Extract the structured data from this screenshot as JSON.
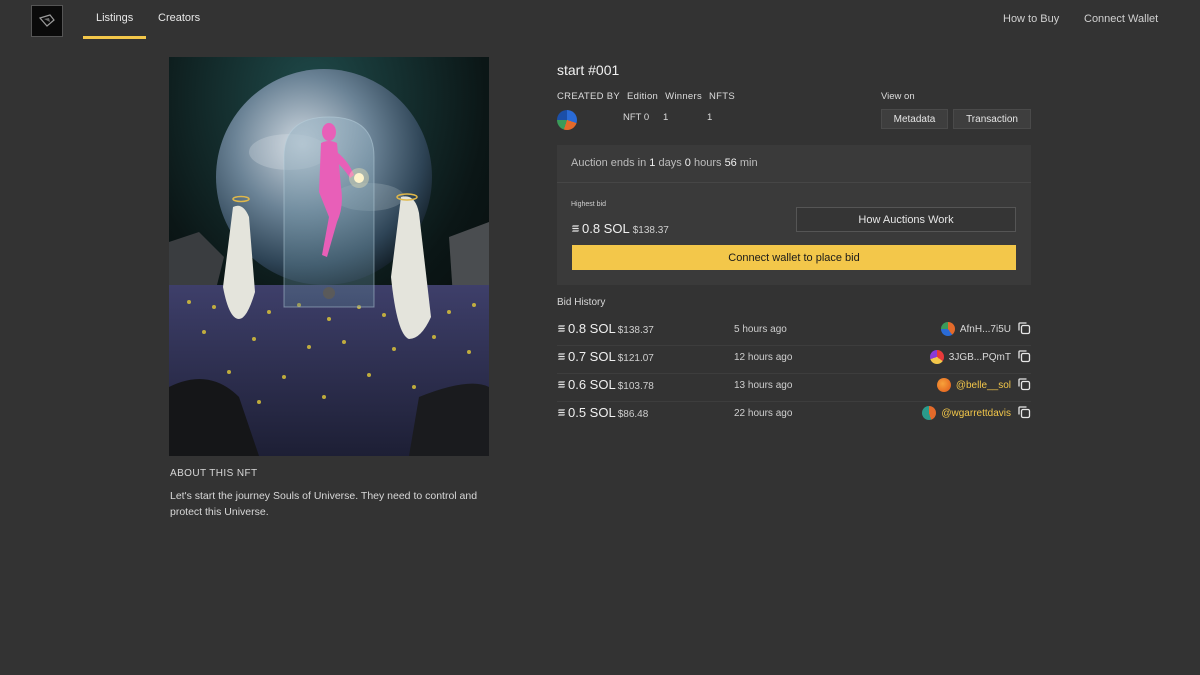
{
  "nav": {
    "tabs": [
      {
        "label": "Listings",
        "active": true
      },
      {
        "label": "Creators",
        "active": false
      }
    ],
    "right": [
      "How to Buy",
      "Connect Wallet"
    ]
  },
  "about": {
    "title": "ABOUT THIS NFT",
    "text": "Let's start the journey Souls of Universe. They need to control and protect this Universe."
  },
  "item": {
    "title": "start #001",
    "labels": {
      "created_by": "CREATED BY",
      "edition": "Edition",
      "winners": "Winners",
      "nfts": "NFTS"
    },
    "values": {
      "edition": "NFT 0",
      "winners": "1",
      "nfts": "1"
    },
    "view_on": "View on",
    "buttons": {
      "metadata": "Metadata",
      "transaction": "Transaction"
    }
  },
  "auction": {
    "ends_label": "Auction ends in",
    "days": "1",
    "days_label": "days",
    "hours": "0",
    "hours_label": "hours",
    "min": "56",
    "min_label": "min",
    "highest_bid_label": "Highest bid",
    "highest_bid": "0.8 SOL",
    "highest_bid_usd": "$138.37",
    "how_button": "How Auctions Work",
    "connect_button": "Connect wallet to place bid"
  },
  "bid_history": {
    "title": "Bid History",
    "rows": [
      {
        "amount": "0.8 SOL",
        "usd": "$138.37",
        "time": "5 hours ago",
        "user": "AfnH...7i5U",
        "highlight": false
      },
      {
        "amount": "0.7 SOL",
        "usd": "$121.07",
        "time": "12 hours ago",
        "user": "3JGB...PQmT",
        "highlight": false
      },
      {
        "amount": "0.6 SOL",
        "usd": "$103.78",
        "time": "13 hours ago",
        "user": "@belle__sol",
        "highlight": true
      },
      {
        "amount": "0.5 SOL",
        "usd": "$86.48",
        "time": "22 hours ago",
        "user": "@wgarrettdavis",
        "highlight": true
      }
    ]
  },
  "colors": {
    "accent": "#f3c74a",
    "background": "#333333",
    "panel": "#3a3a3a"
  }
}
